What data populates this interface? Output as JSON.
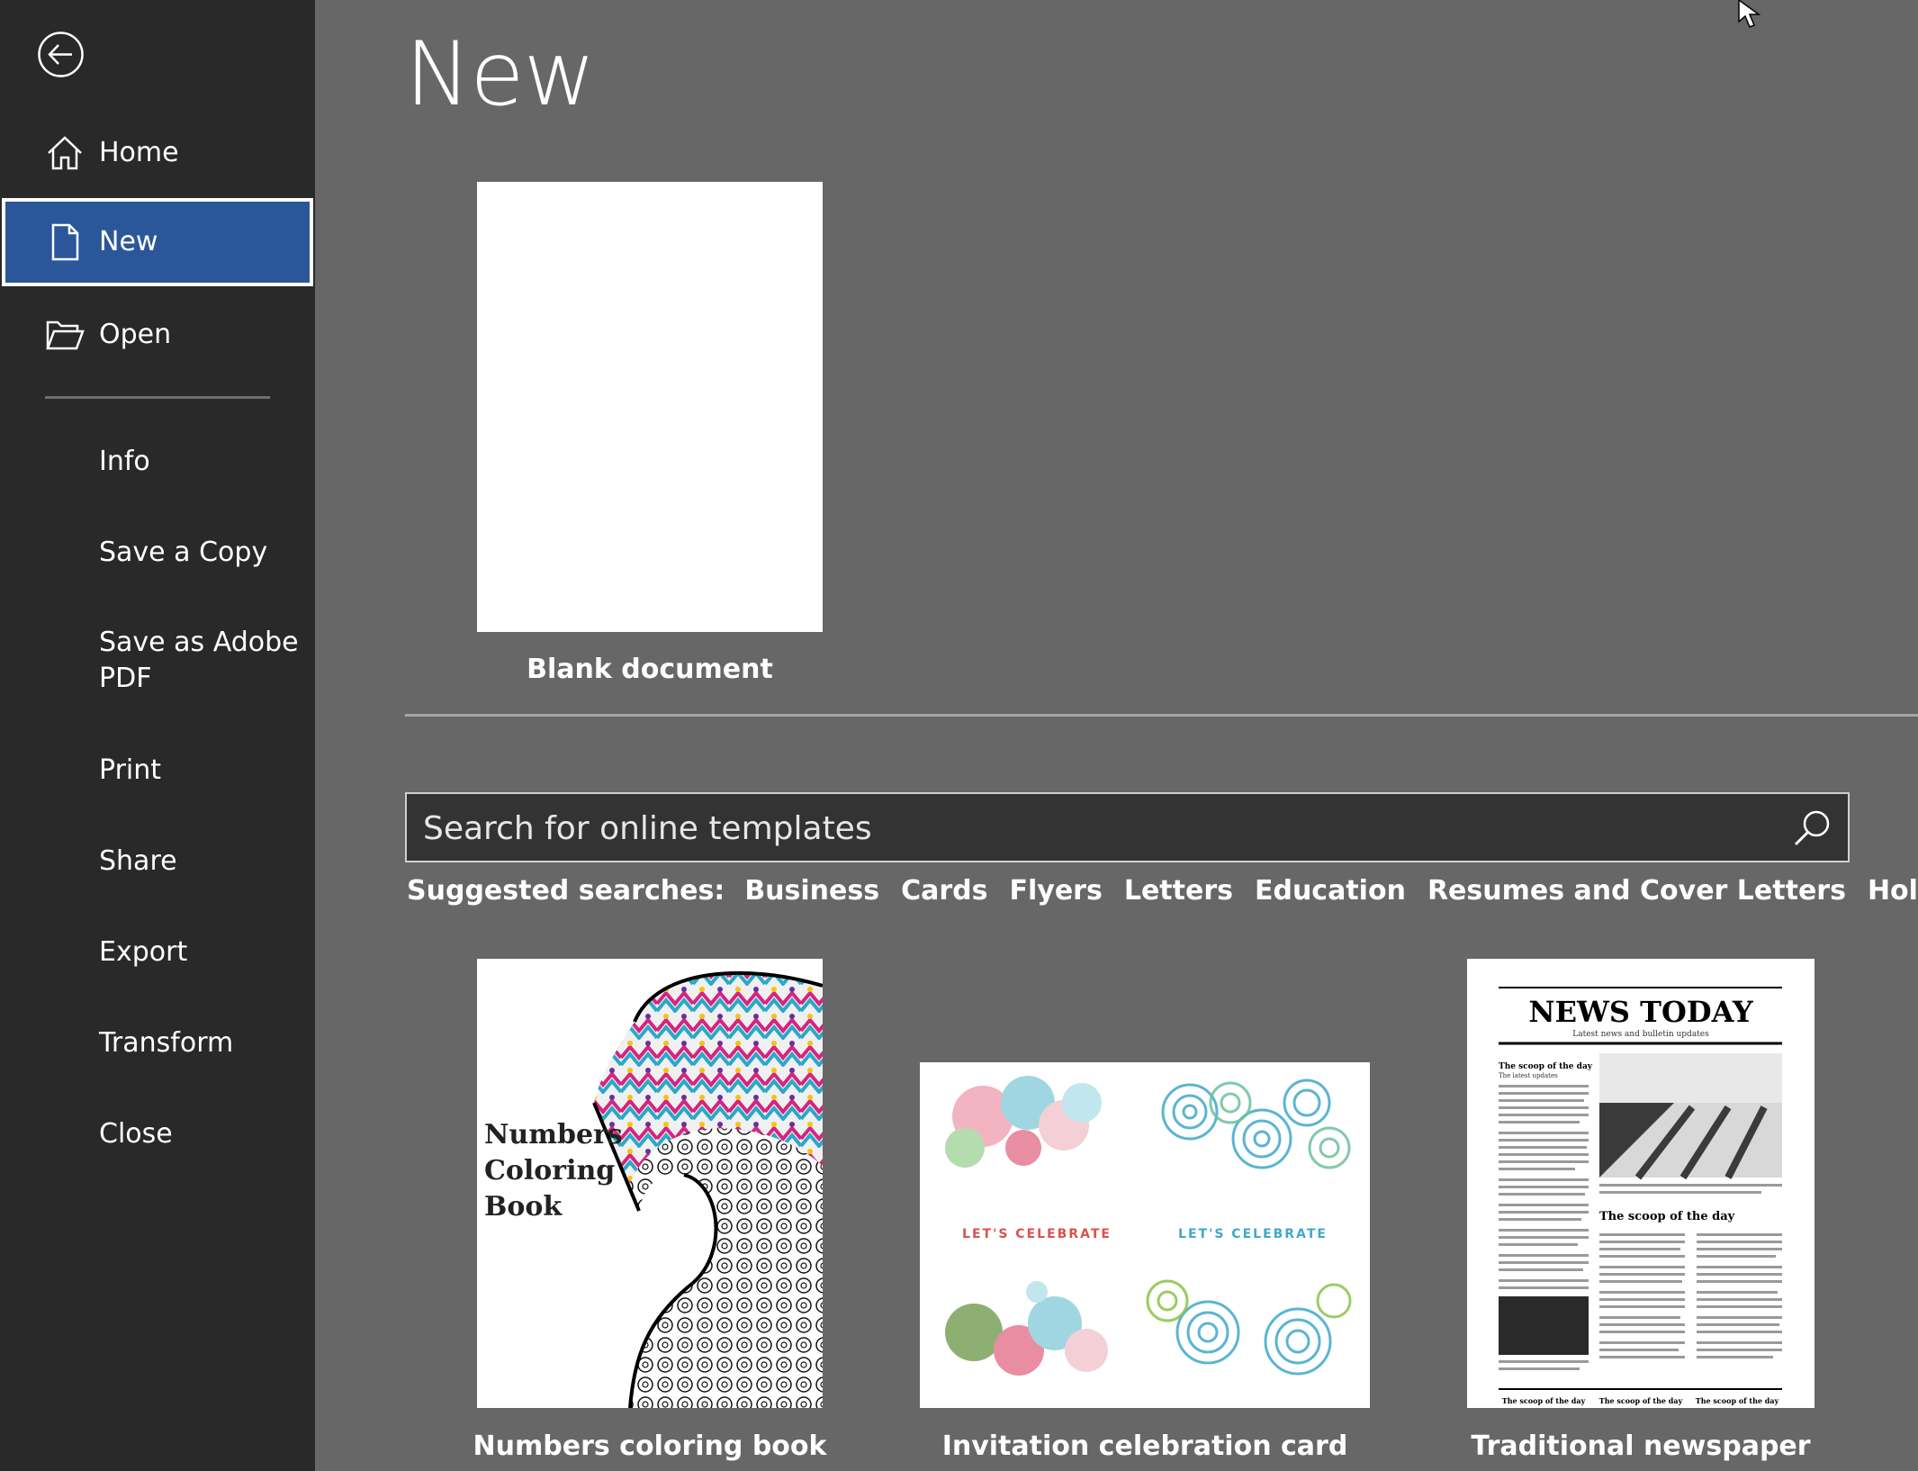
{
  "sidebar": {
    "nav": [
      {
        "label": "Home",
        "icon": "home-icon"
      },
      {
        "label": "New",
        "icon": "document-icon",
        "selected": true
      },
      {
        "label": "Open",
        "icon": "folder-open-icon"
      }
    ],
    "items": [
      "Info",
      "Save a Copy",
      "Save as Adobe",
      "PDF",
      "Print",
      "Share",
      "Export",
      "Transform",
      "Close"
    ]
  },
  "main": {
    "title": "New",
    "blank_label": "Blank document",
    "search": {
      "placeholder": "Search for online templates"
    },
    "suggested": {
      "label": "Suggested searches:",
      "items": [
        "Business",
        "Cards",
        "Flyers",
        "Letters",
        "Education",
        "Resumes and Cover Letters",
        "Holiday"
      ]
    },
    "templates": [
      {
        "label": "Numbers coloring book",
        "thumb_text": [
          "Numbers",
          "Coloring",
          "Book"
        ],
        "digit": "2"
      },
      {
        "label": "Invitation celebration card",
        "thumb_text": "LET'S CELEBRATE"
      },
      {
        "label": "Traditional newspaper",
        "thumb_text": {
          "masthead": "NEWS TODAY",
          "tagline": "Latest news and bulletin updates",
          "headline": "The scoop of the day",
          "sub": "The latest updates",
          "footer": "The scoop of the day"
        }
      }
    ]
  },
  "colors": {
    "sidebar": "#292929",
    "selected": "#2b579a",
    "background": "#676767"
  }
}
